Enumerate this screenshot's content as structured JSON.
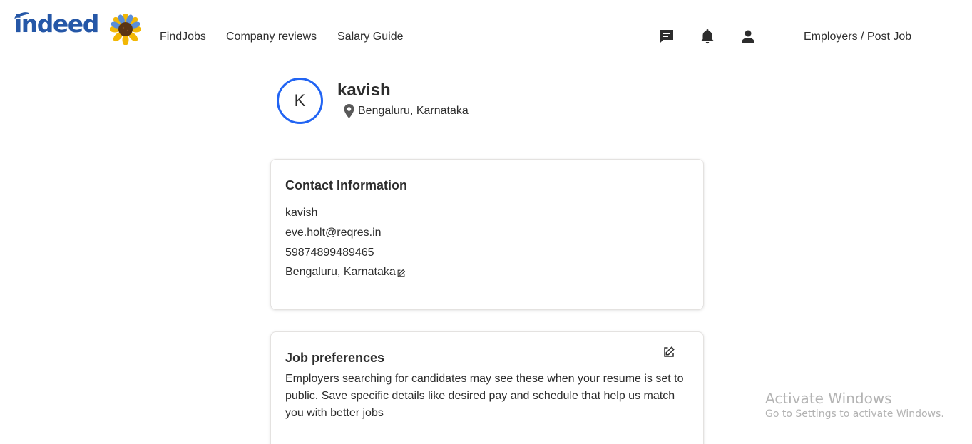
{
  "header": {
    "logo_text": "indeed",
    "nav": {
      "find_jobs": "FindJobs",
      "company_reviews": "Company reviews",
      "salary_guide": "Salary Guide"
    },
    "employers_link": "Employers / Post Job",
    "icons": [
      "message-icon",
      "bell-icon",
      "person-icon",
      "sunflower-logo-icon"
    ]
  },
  "profile": {
    "initial": "K",
    "name": "kavish",
    "location": "Bengaluru, Karnataka"
  },
  "contact": {
    "title": "Contact Information",
    "name": "kavish",
    "email": "eve.holt@reqres.in",
    "phone": "59874899489465",
    "location": "Bengaluru, Karnataka"
  },
  "job_preferences": {
    "title": "Job preferences",
    "description": "Employers searching for candidates may see these when your resume is set to public. Save specific details like desired pay and schedule that help us match you with better jobs"
  },
  "watermark": {
    "title": "Activate Windows",
    "subtitle": "Go to Settings to activate Windows."
  },
  "colors": {
    "brand_blue": "#2557a7",
    "avatar_ring": "#2164f3",
    "text": "#2d2d2d",
    "border": "#e4e2e0"
  }
}
